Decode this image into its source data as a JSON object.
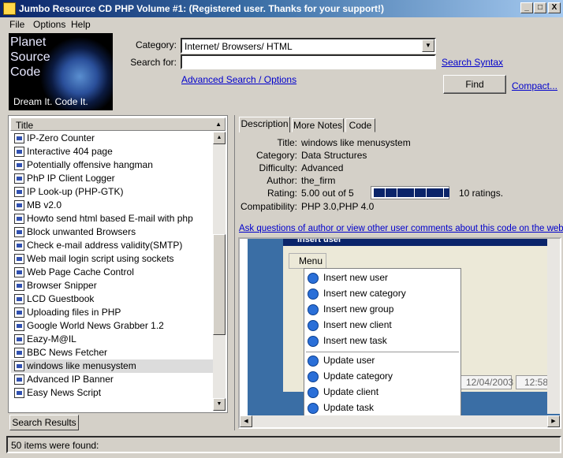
{
  "window": {
    "title": "Jumbo Resource CD PHP Volume #1: (Registered user.  Thanks for your support!)",
    "btn_min": "_",
    "btn_max": "□",
    "btn_close": "X"
  },
  "menu": [
    "File",
    "Options",
    "Help"
  ],
  "logo": {
    "lines": [
      "Planet",
      "Source",
      "Code"
    ],
    "tagline": "Dream It.  Code It."
  },
  "search": {
    "category_label": "Category:",
    "category_value": "Internet/ Browsers/ HTML",
    "searchfor_label": "Search for:",
    "searchfor_value": "",
    "syntax_link": "Search Syntax",
    "advanced_link": "Advanced Search / Options",
    "find_button": "Find",
    "compact_link": "Compact..."
  },
  "list": {
    "header": "Title",
    "items": [
      "IP-Zero Counter",
      "Interactive 404 page",
      "Potentially offensive hangman",
      "PhP IP Client Logger",
      "IP Look-up (PHP-GTK)",
      "MB v2.0",
      "Howto send html based E-mail with php",
      "Block unwanted Browsers",
      "Check e-mail address validity(SMTP)",
      "Web mail login script using sockets",
      "Web Page Cache Control",
      "Browser Snipper",
      "LCD Guestbook",
      "Uploading files in PHP",
      "Google World News Grabber 1.2",
      "Eazy-M@IL",
      "BBC News Fetcher",
      "windows like menusystem",
      "Advanced IP Banner",
      "Easy News Script"
    ],
    "selected": "windows like menusystem",
    "tab": "Search Results"
  },
  "detail": {
    "tabs": [
      "Description",
      "More Notes",
      "Code"
    ],
    "title_label": "Title:",
    "title": "windows like menusystem",
    "category_label": "Category:",
    "category": "Data Structures",
    "difficulty_label": "Difficulty:",
    "difficulty": "Advanced",
    "author_label": "Author:",
    "author": "the_firm",
    "rating_label": "Rating:",
    "rating": "5.00 out of 5",
    "rating_fraction": 1.0,
    "ratings_count": "10 ratings.",
    "compat_label": "Compatibility:",
    "compat": "PHP 3.0,PHP 4.0",
    "ask_link": "Ask questions of author or view other user comments about this code on the web..."
  },
  "preview": {
    "window_title": "Insert user",
    "menu_label": "Menu",
    "items_a": [
      "Insert new user",
      "Insert new category",
      "Insert new group",
      "Insert new client",
      "Insert new task"
    ],
    "items_b": [
      "Update user",
      "Update category",
      "Update client",
      "Update task"
    ],
    "date": "12/04/2003",
    "time": "12:58"
  },
  "status": {
    "text": "50 items were found:"
  }
}
